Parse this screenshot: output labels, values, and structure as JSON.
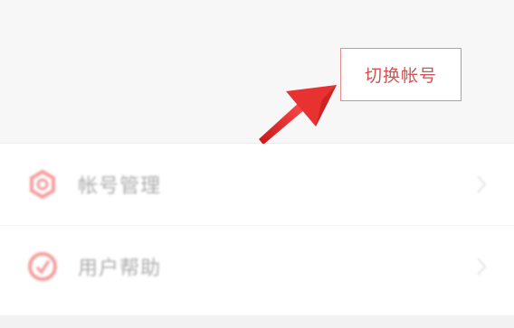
{
  "callout": {
    "label": "切换帐号"
  },
  "menu": {
    "items": [
      {
        "label": "帐号管理",
        "icon": "gear-icon"
      },
      {
        "label": "用户帮助",
        "icon": "help-icon"
      }
    ]
  },
  "colors": {
    "accent": "#e03a3a",
    "callout_border": "#e58a8a",
    "callout_text": "#d25151",
    "icon": "#f06a6a"
  }
}
